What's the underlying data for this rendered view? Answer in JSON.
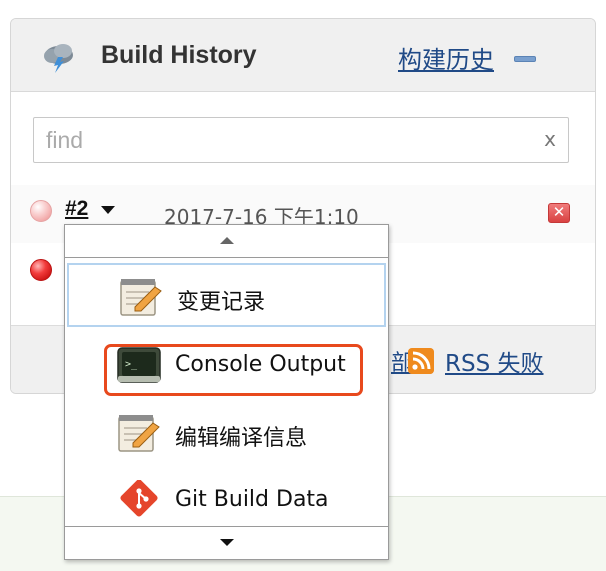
{
  "widget": {
    "title": "Build History",
    "trend_link": "构建历史",
    "collapse_icon": "collapse-minus-icon",
    "header_icon": "cloud-lightning-icon"
  },
  "search": {
    "value": "",
    "placeholder": "find",
    "clear_label": "x"
  },
  "builds": [
    {
      "number": "#2",
      "date": "2017-7-16 下午1:10",
      "status_color": "#f2a9a9",
      "status_icon": "pending-ball-icon"
    },
    {
      "number": "",
      "date": "",
      "status_color": "#e01c1c",
      "status_icon": "failed-ball-icon"
    }
  ],
  "footer": {
    "partial_text": "部",
    "rss_failed_label": "RSS 失败",
    "rss_icon": "rss-icon"
  },
  "build_menu": {
    "items": [
      {
        "label": "变更记录",
        "icon": "notepad-pencil-icon",
        "selected": true
      },
      {
        "label": "Console Output",
        "icon": "terminal-icon",
        "selected": false
      },
      {
        "label": "编辑编译信息",
        "icon": "notepad-pencil-icon",
        "selected": false
      },
      {
        "label": "Git Build Data",
        "icon": "git-icon",
        "selected": false
      }
    ]
  },
  "colors": {
    "link": "#204a87",
    "highlight": "#e8491d",
    "selected_border": "#b4d3ef",
    "panel_bg": "#f0f0f0"
  }
}
